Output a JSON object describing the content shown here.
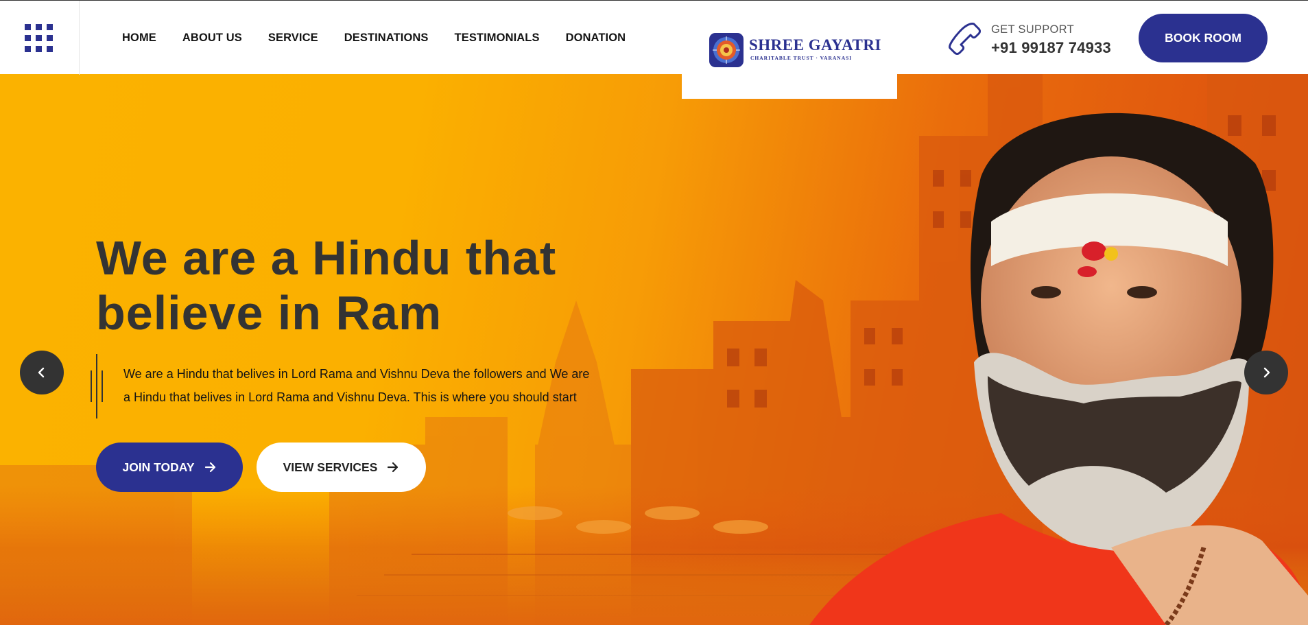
{
  "header": {
    "menu_icon": "grid-menu-icon",
    "nav": [
      {
        "label": "HOME"
      },
      {
        "label": "ABOUT US"
      },
      {
        "label": "SERVICE"
      },
      {
        "label": "DESTINATIONS"
      },
      {
        "label": "TESTIMONIALS"
      },
      {
        "label": "DONATION"
      }
    ],
    "logo": {
      "title": "SHREE GAYATRI",
      "subtitle": "CHARITABLE TRUST · VARANASI"
    },
    "support": {
      "icon": "phone-icon",
      "label": "GET SUPPORT",
      "phone": "+91 99187 74933"
    },
    "book_label": "BOOK ROOM"
  },
  "hero": {
    "title": "We are a Hindu that believe in Ram",
    "description": "We are a Hindu that belives in Lord Rama and Vishnu Deva the followers and We are a Hindu that belives in Lord Rama and Vishnu Deva. This is where you should start",
    "join_label": "JOIN TODAY",
    "view_label": "VIEW SERVICES",
    "prev_icon": "chevron-left-icon",
    "next_icon": "chevron-right-icon"
  },
  "colors": {
    "brand": "#2b3190",
    "hero_yellow": "#fbb200",
    "hero_orange": "#e8590c",
    "dark": "#333333"
  }
}
